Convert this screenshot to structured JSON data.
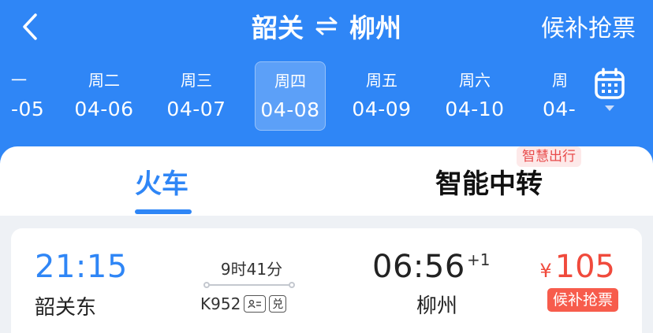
{
  "header": {
    "from": "韶关",
    "swap_icon": "swap-arrows-icon",
    "to": "柳州",
    "standby_label": "候补抢票"
  },
  "dates": [
    {
      "dow": "一",
      "date": "-05"
    },
    {
      "dow": "周二",
      "date": "04-06"
    },
    {
      "dow": "周三",
      "date": "04-07"
    },
    {
      "dow": "周四",
      "date": "04-08",
      "selected": true
    },
    {
      "dow": "周五",
      "date": "04-09"
    },
    {
      "dow": "周六",
      "date": "04-10"
    },
    {
      "dow": "周",
      "date": "04-"
    }
  ],
  "tabs": {
    "train": "火车",
    "transfer": "智能中转",
    "badge": "智慧出行"
  },
  "train": {
    "dep_time": "21:15",
    "dep_station": "韶关东",
    "duration": "9时41分",
    "train_no": "K952",
    "service_icon_1": "ID",
    "service_icon_2": "兑",
    "arr_time": "06:56",
    "day_offset": "+1",
    "arr_station": "柳州",
    "currency": "¥",
    "price": "105",
    "standby_label": "候补抢票"
  },
  "colors": {
    "header_blue": "#2f86f6",
    "price_red": "#f04a3c",
    "badge_red": "#f75c4c"
  }
}
